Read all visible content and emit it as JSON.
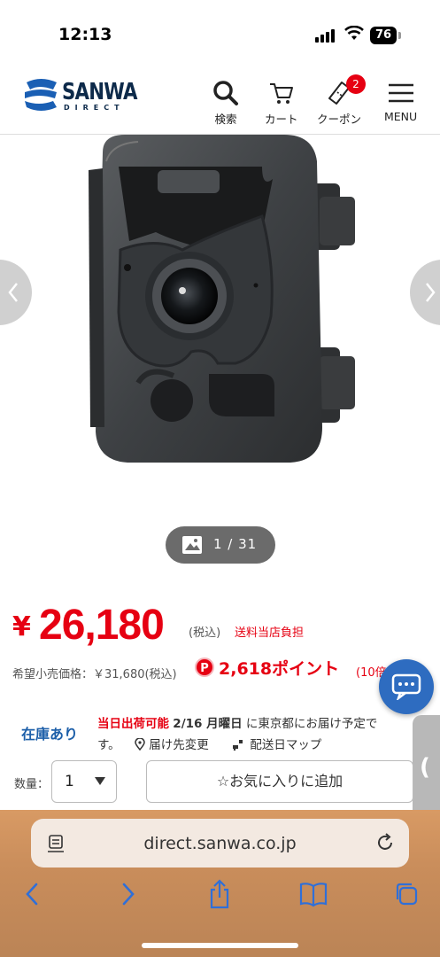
{
  "status_bar": {
    "time": "12:13",
    "battery": "76"
  },
  "header": {
    "logo_text": "SANWA",
    "logo_sub": "DIRECT",
    "nav": {
      "search_label": "検索",
      "cart_label": "カート",
      "coupon_label": "クーポン",
      "coupon_badge": "2",
      "menu_label": "MENU"
    }
  },
  "gallery": {
    "counter": "1 / 31"
  },
  "price": {
    "currency": "¥",
    "amount": "26,180",
    "tax_note": "(税込)",
    "shipping_note": "送料当店負担",
    "msrp": "希望小売価格：￥31,680(税込)",
    "point_badge": "P",
    "points": "2,618ポイント",
    "points_rate": "(10倍"
  },
  "stock": {
    "status": "在庫あり",
    "same_day": "当日出荷可能",
    "date": "2/16 月曜日",
    "line1_suffix": "に東京都にお届け予定で",
    "line2_prefix": "す。",
    "change_dest": "届け先変更",
    "delivery_map": "配送日マップ"
  },
  "quantity": {
    "label": "数量：",
    "value": "1"
  },
  "favorite_button": "☆お気に入りに追加",
  "side_tab": "(",
  "browser": {
    "url": "direct.sanwa.co.jp"
  },
  "colors": {
    "brand_red": "#e60012",
    "brand_blue": "#1d5fa9",
    "chat_blue": "#2e6cc0"
  }
}
